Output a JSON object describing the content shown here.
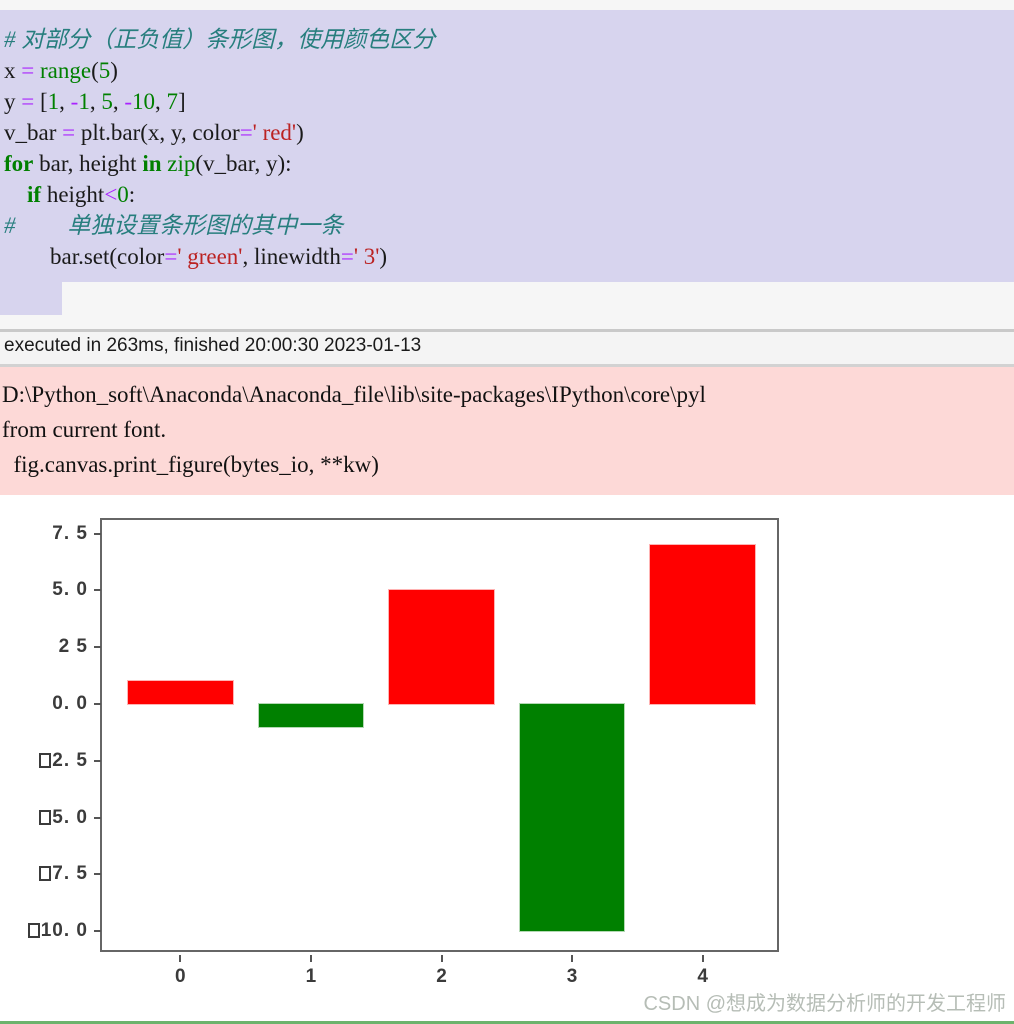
{
  "notebook": {
    "code_cell": {
      "language": "python",
      "lines": [
        [
          {
            "t": "comment",
            "s": "# 对部分（正负值）条形图，使用颜色区分"
          }
        ],
        [
          {
            "t": "plain",
            "s": "x "
          },
          {
            "t": "op",
            "s": "="
          },
          {
            "t": "plain",
            "s": " "
          },
          {
            "t": "fn",
            "s": "range"
          },
          {
            "t": "plain",
            "s": "("
          },
          {
            "t": "num",
            "s": "5"
          },
          {
            "t": "plain",
            "s": ")"
          }
        ],
        [
          {
            "t": "plain",
            "s": "y "
          },
          {
            "t": "op",
            "s": "="
          },
          {
            "t": "plain",
            "s": " ["
          },
          {
            "t": "num",
            "s": "1"
          },
          {
            "t": "plain",
            "s": ", "
          },
          {
            "t": "op",
            "s": "-"
          },
          {
            "t": "num",
            "s": "1"
          },
          {
            "t": "plain",
            "s": ", "
          },
          {
            "t": "num",
            "s": "5"
          },
          {
            "t": "plain",
            "s": ", "
          },
          {
            "t": "op",
            "s": "-"
          },
          {
            "t": "num",
            "s": "10"
          },
          {
            "t": "plain",
            "s": ", "
          },
          {
            "t": "num",
            "s": "7"
          },
          {
            "t": "plain",
            "s": "]"
          }
        ],
        [
          {
            "t": "plain",
            "s": "v_bar "
          },
          {
            "t": "op",
            "s": "="
          },
          {
            "t": "plain",
            "s": " plt.bar(x, y, color"
          },
          {
            "t": "op",
            "s": "="
          },
          {
            "t": "str",
            "s": "' red'"
          },
          {
            "t": "plain",
            "s": ")"
          }
        ],
        [
          {
            "t": "kw",
            "s": "for"
          },
          {
            "t": "plain",
            "s": " bar, height "
          },
          {
            "t": "kw",
            "s": "in"
          },
          {
            "t": "plain",
            "s": " "
          },
          {
            "t": "fn",
            "s": "zip"
          },
          {
            "t": "plain",
            "s": "(v_bar, y):"
          }
        ],
        [
          {
            "t": "plain",
            "s": "    "
          },
          {
            "t": "kw",
            "s": "if"
          },
          {
            "t": "plain",
            "s": " height"
          },
          {
            "t": "op",
            "s": "<"
          },
          {
            "t": "num",
            "s": "0"
          },
          {
            "t": "plain",
            "s": ":"
          }
        ],
        [
          {
            "t": "comment",
            "s": "#         单独设置条形图的其中一条"
          }
        ],
        [
          {
            "t": "plain",
            "s": "        bar.set(color"
          },
          {
            "t": "op",
            "s": "="
          },
          {
            "t": "str",
            "s": "' green'"
          },
          {
            "t": "plain",
            "s": ", linewidth"
          },
          {
            "t": "op",
            "s": "="
          },
          {
            "t": "str",
            "s": "' 3'"
          },
          {
            "t": "plain",
            "s": ")"
          }
        ]
      ]
    },
    "execution_status": "executed in 263ms, finished 20:00:30 2023-01-13",
    "stderr_output": [
      "D:\\Python_soft\\Anaconda\\Anaconda_file\\lib\\site-packages\\IPython\\core\\pyl",
      "from current font.",
      "  fig.canvas.print_figure(bytes_io, **kw)"
    ]
  },
  "watermark": "CSDN @想成为数据分析师的开发工程师",
  "colors": {
    "code_cell_bg": "#d7d4ee",
    "stderr_bg": "#fdd9d7",
    "exec_bar_bg": "#f4f4f4",
    "page_bg": "#f6f6f6",
    "bar_positive": "#ff0000",
    "bar_negative": "#008000",
    "axis": "#666666",
    "tick_text": "#3b3b3b",
    "watermark": "#b6bdb6",
    "bottom_rule": "#6cb36c"
  },
  "chart_data": {
    "type": "bar",
    "title": "",
    "xlabel": "",
    "ylabel": "",
    "categories": [
      "0",
      "1",
      "2",
      "3",
      "4"
    ],
    "x": [
      0,
      1,
      2,
      3,
      4
    ],
    "values": [
      1,
      -1,
      5,
      -10,
      7
    ],
    "bar_colors": [
      "#ff0000",
      "#008000",
      "#ff0000",
      "#008000",
      "#ff0000"
    ],
    "bar_width": 0.8,
    "xlim": [
      -0.6,
      4.6
    ],
    "ylim": [
      -11.0,
      8.1
    ],
    "grid": false,
    "legend": null,
    "xticks": [
      0,
      1,
      2,
      3,
      4
    ],
    "xtick_labels": [
      "0",
      "1",
      "2",
      "3",
      "4"
    ],
    "yticks": [
      7.5,
      5.0,
      2.5,
      0.0,
      -2.5,
      -5.0,
      -7.5,
      -10.0
    ],
    "ytick_labels": [
      "7. 5",
      "5. 0",
      "2 5",
      "0. 0",
      "□2. 5",
      "□5. 0",
      "□7. 5",
      "□10. 0"
    ],
    "ytick_labels_note": "negative signs render as missing-glyph boxes"
  }
}
